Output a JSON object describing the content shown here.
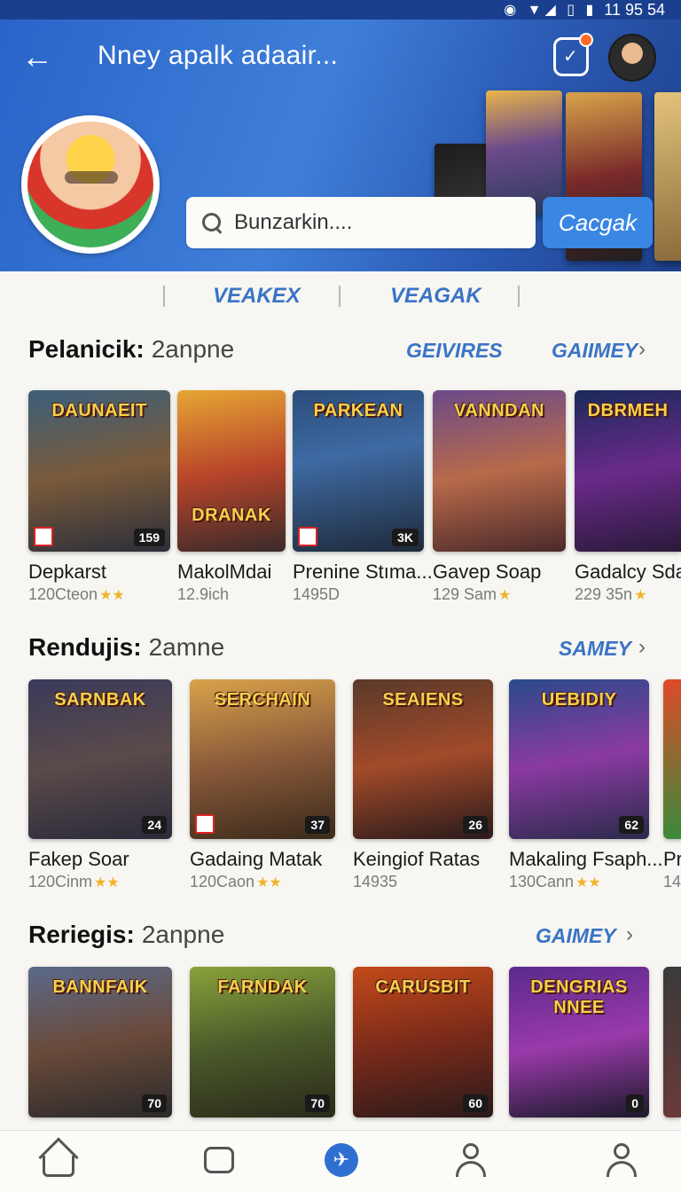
{
  "status_bar": {
    "icons": "◉ ▼◢ ▯ ▮",
    "time": "11 95 54"
  },
  "header": {
    "title": "Nney apalk adaair...",
    "search_placeholder": "Bunzarkin....",
    "search_button": "Cacgak"
  },
  "tabs": [
    "VEAKEX",
    "VEAGAK"
  ],
  "sections": [
    {
      "title": "Pelanicik:",
      "subtitle": "2anpne",
      "links": [
        "GEIVIRES",
        "GAIIMEY"
      ],
      "cards": [
        {
          "logo": "DAUNAEIT",
          "name": "Depkarst",
          "meta": "120Cteon",
          "stars": "★★",
          "badge": "159"
        },
        {
          "logo": "DRANAK",
          "name": "MakolMdai",
          "meta": "12.9ich",
          "stars": "",
          "badge": ""
        },
        {
          "logo": "PARKEAN",
          "name": "Prenine Stıma...",
          "meta": "1495D",
          "stars": "",
          "badge": "3K"
        },
        {
          "logo": "VANNDAN",
          "name": "Gavep Soap",
          "meta": "129 Sam",
          "stars": "★",
          "badge": ""
        },
        {
          "logo": "DBRMEH",
          "name": "Gadalcy Sdap",
          "meta": "229 35n",
          "stars": "★",
          "badge": ""
        }
      ]
    },
    {
      "title": "Rendujis:",
      "subtitle": "2amne",
      "links": [
        "SAMEY"
      ],
      "cards": [
        {
          "logo": "SARNBAK",
          "name": "Fakep Soar",
          "meta": "120Cinm",
          "stars": "★★",
          "badge": "24"
        },
        {
          "logo": "SERCHAIN",
          "name": "Gadaing Matak",
          "meta": "120Caon",
          "stars": "★★",
          "badge": "37"
        },
        {
          "logo": "SEAIENS",
          "name": "Keingiof Ratas",
          "meta": "14935",
          "stars": "",
          "badge": "26"
        },
        {
          "logo": "UEBIDIY",
          "name": "Makaling Fsaph...",
          "meta": "130Cann",
          "stars": "★★",
          "badge": "62"
        },
        {
          "logo": "",
          "name": "Pr",
          "meta": "14",
          "stars": "",
          "badge": ""
        }
      ]
    },
    {
      "title": "Reriegis:",
      "subtitle": "2anpne",
      "links": [
        "GAIMEY"
      ],
      "cards": [
        {
          "logo": "BANNFAIK",
          "name": "",
          "meta": "",
          "stars": "",
          "badge": "70"
        },
        {
          "logo": "FARNDAK",
          "name": "",
          "meta": "",
          "stars": "",
          "badge": "70"
        },
        {
          "logo": "CARUSBIT",
          "name": "",
          "meta": "",
          "stars": "",
          "badge": "60"
        },
        {
          "logo": "DENGRIAS NNEE",
          "name": "",
          "meta": "",
          "stars": "",
          "badge": "0"
        },
        {
          "logo": "",
          "name": "",
          "meta": "",
          "stars": "",
          "badge": ""
        }
      ]
    }
  ],
  "nav": [
    "home-icon",
    "square-icon",
    "send-icon",
    "people-icon",
    "profile-icon"
  ],
  "colors": {
    "accent": "#3a74c5",
    "header": "#2a64c9",
    "search_button": "#3a86e3"
  }
}
